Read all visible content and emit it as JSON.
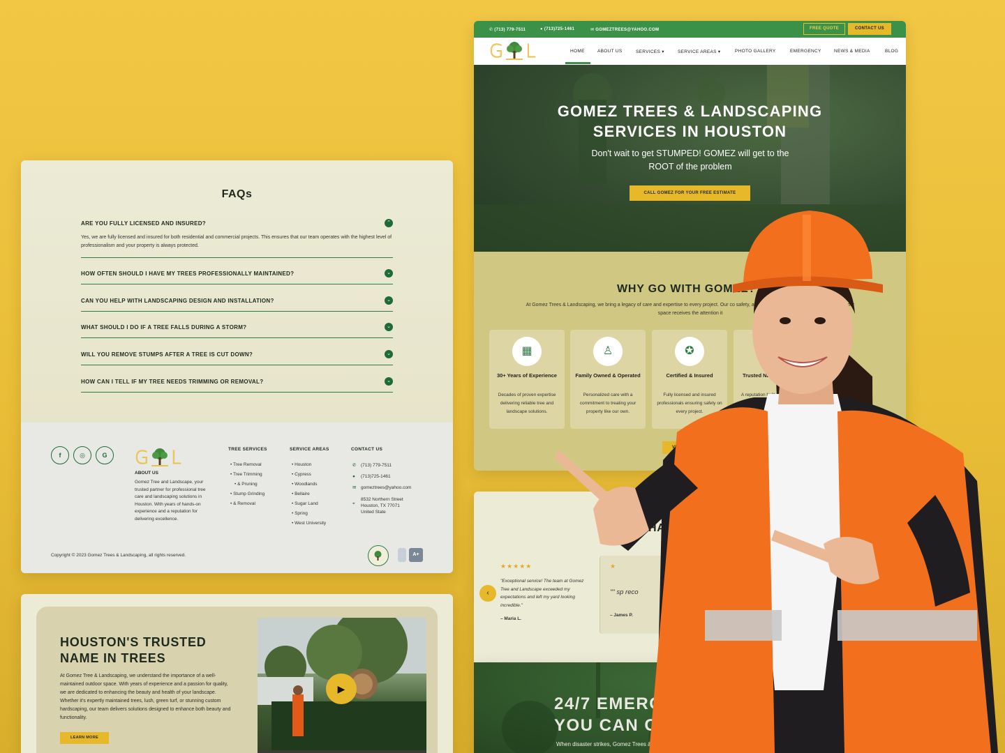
{
  "faq": {
    "title": "FAQs",
    "items": [
      {
        "q": "ARE YOU FULLY LICENSED AND INSURED?",
        "a": "Yes, we are fully licensed and insured for both residential and commercial projects. This ensures that our team operates with the highest level of professionalism and your property is always protected."
      },
      {
        "q": "HOW OFTEN SHOULD I HAVE MY TREES PROFESSIONALLY MAINTAINED?"
      },
      {
        "q": "CAN YOU HELP WITH LANDSCAPING DESIGN AND INSTALLATION?"
      },
      {
        "q": "WHAT SHOULD I DO IF A TREE FALLS DURING A STORM?"
      },
      {
        "q": "WILL YOU REMOVE STUMPS AFTER A TREE IS CUT DOWN?"
      },
      {
        "q": "HOW CAN I TELL IF MY TREE NEEDS TRIMMING OR REMOVAL?"
      }
    ]
  },
  "footer": {
    "social": [
      "f",
      "◎",
      "G"
    ],
    "logo": {
      "left": "G",
      "right": "L"
    },
    "about_title": "ABOUT US",
    "about_text": "Gomez Tree and Landscape, your trusted partner for professional tree care and landscaping solutions in Houston. With years of hands-on experience and a reputation for delivering excellence.",
    "tree_services_title": "TREE SERVICES",
    "tree_services": [
      "Tree Removal",
      "Tree Trimming",
      "& Pruning",
      "Stump Grinding",
      "& Removal"
    ],
    "service_areas_title": "SERVICE AREAS",
    "service_areas": [
      "Houston",
      "Cypress",
      "Woodlands",
      "Bellaire",
      "Sugar Land",
      "Spring",
      "West University"
    ],
    "contact_title": "CONTACT US",
    "contact": {
      "phone1": "(713) 779-7511",
      "phone2": "(713)725-1461",
      "email": "gomeztrees@yahoo.com",
      "address1": "8532 Northern Street",
      "address2": "Houston, TX 77071",
      "address3": "United State"
    },
    "copyright": "Copyright © 2023 Gomez Trees & Landscaping, all rights reserved.",
    "badge_text": "A+"
  },
  "houston": {
    "title": "HOUSTON'S TRUSTED NAME IN TREES",
    "text": "At Gomez Tree & Landscaping, we understand the importance of a well-maintained outdoor space. With years of experience and a passion for quality, we are dedicated to enhancing the beauty and health of your landscape. Whether it's expertly maintained trees, lush, green turf, or stunning custom hardscaping, our team delivers solutions designed to enhance both beauty and functionality.",
    "button": "LEARN MORE",
    "play": "▶"
  },
  "site": {
    "topbar": {
      "phone1": "(713) 779-7511",
      "phone2": "(713)725-1461",
      "email": "GOMEZTREES@YAHOO.COM",
      "free_quote": "FREE QUOTE",
      "contact_us": "CONTACT US"
    },
    "nav": [
      "HOME",
      "ABOUT US",
      "SERVICES ▾",
      "SERVICE AREAS ▾",
      "PHOTO GALLERY",
      "EMERGENCY",
      "NEWS & MEDIA",
      "BLOG"
    ],
    "hero": {
      "title_line1": "GOMEZ TREES & LANDSCAPING",
      "title_line2": "SERVICES IN HOUSTON",
      "subtitle": "Don't wait to get STUMPED! GOMEZ will get to the ROOT of the problem",
      "cta": "CALL GOMEZ FOR YOUR FREE ESTIMATE"
    },
    "why": {
      "title": "WHY GO WITH GOMEZ?",
      "text": "At Gomez Trees & Landscaping, we bring a legacy of care and expertise to every project. Our co safety, and customer satisfaction ensures your outdoor space receives the attention it",
      "features": [
        {
          "icon": "▦",
          "title": "30+ Years of Experience",
          "text": "Decades of proven expertise delivering reliable tree and landscape solutions."
        },
        {
          "icon": "♙",
          "title": "Family Owned & Operated",
          "text": "Personalized care with a commitment to treating your property like our own."
        },
        {
          "icon": "✪",
          "title": "Certified & Insured",
          "text": "Fully licensed and insured professionals ensuring safety on every project."
        },
        {
          "icon": "✧",
          "title": "Trusted Name Houston",
          "text": "A reputation built quality, integ exception hom"
        }
      ],
      "view_button": "VIEW S"
    }
  },
  "reviews": {
    "title": "UR HAP",
    "prev": "‹",
    "review1": {
      "stars": "★★★★★",
      "text": "\"Exceptional service! The team at Gomez Tree and Landscape exceeded my expectations and left my yard looking incredible.\"",
      "author": "– Maria L."
    },
    "review2": {
      "mark": "★",
      "text": "\"\" sp reco",
      "author": "– James P."
    }
  },
  "emergency": {
    "title_line1": "24/7 EMERGENCY",
    "title_line2": "YOU CAN CO",
    "text": "When disaster strikes, Gomez Trees & Landscaping C"
  }
}
